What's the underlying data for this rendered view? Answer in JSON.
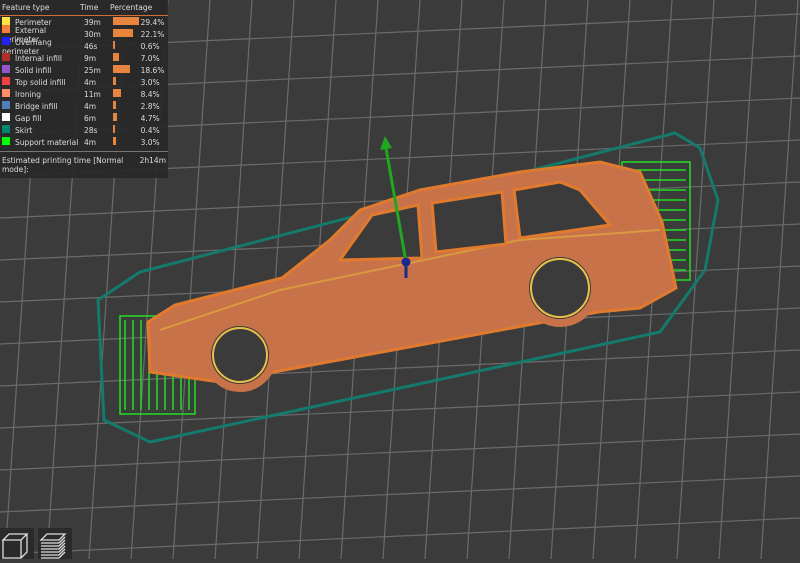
{
  "legend": {
    "headers": {
      "feature": "Feature type",
      "time": "Time",
      "percentage": "Percentage"
    },
    "items": [
      {
        "label": "Perimeter",
        "time": "39m",
        "pct": "29.4%",
        "value": 29.4,
        "color": "#ffe63c"
      },
      {
        "label": "External perimeter",
        "time": "30m",
        "pct": "22.1%",
        "value": 22.1,
        "color": "#ff7d38"
      },
      {
        "label": "Overhang perimeter",
        "time": "46s",
        "pct": "0.6%",
        "value": 0.6,
        "color": "#1f1fff"
      },
      {
        "label": "Internal infill",
        "time": "9m",
        "pct": "7.0%",
        "value": 7.0,
        "color": "#b03029"
      },
      {
        "label": "Solid infill",
        "time": "25m",
        "pct": "18.6%",
        "value": 18.6,
        "color": "#9654cc"
      },
      {
        "label": "Top solid infill",
        "time": "4m",
        "pct": "3.0%",
        "value": 3.0,
        "color": "#f04040"
      },
      {
        "label": "Ironing",
        "time": "11m",
        "pct": "8.4%",
        "value": 8.4,
        "color": "#ff8c69"
      },
      {
        "label": "Bridge infill",
        "time": "4m",
        "pct": "2.8%",
        "value": 2.8,
        "color": "#4d80ba"
      },
      {
        "label": "Gap fill",
        "time": "6m",
        "pct": "4.7%",
        "value": 4.7,
        "color": "#ffffff"
      },
      {
        "label": "Skirt",
        "time": "28s",
        "pct": "0.4%",
        "value": 0.4,
        "color": "#00876e"
      },
      {
        "label": "Support material",
        "time": "4m",
        "pct": "3.0%",
        "value": 3.0,
        "color": "#00ff00"
      }
    ],
    "estimate_label": "Estimated printing time [Normal mode]:",
    "estimate_value": "2h14m"
  }
}
